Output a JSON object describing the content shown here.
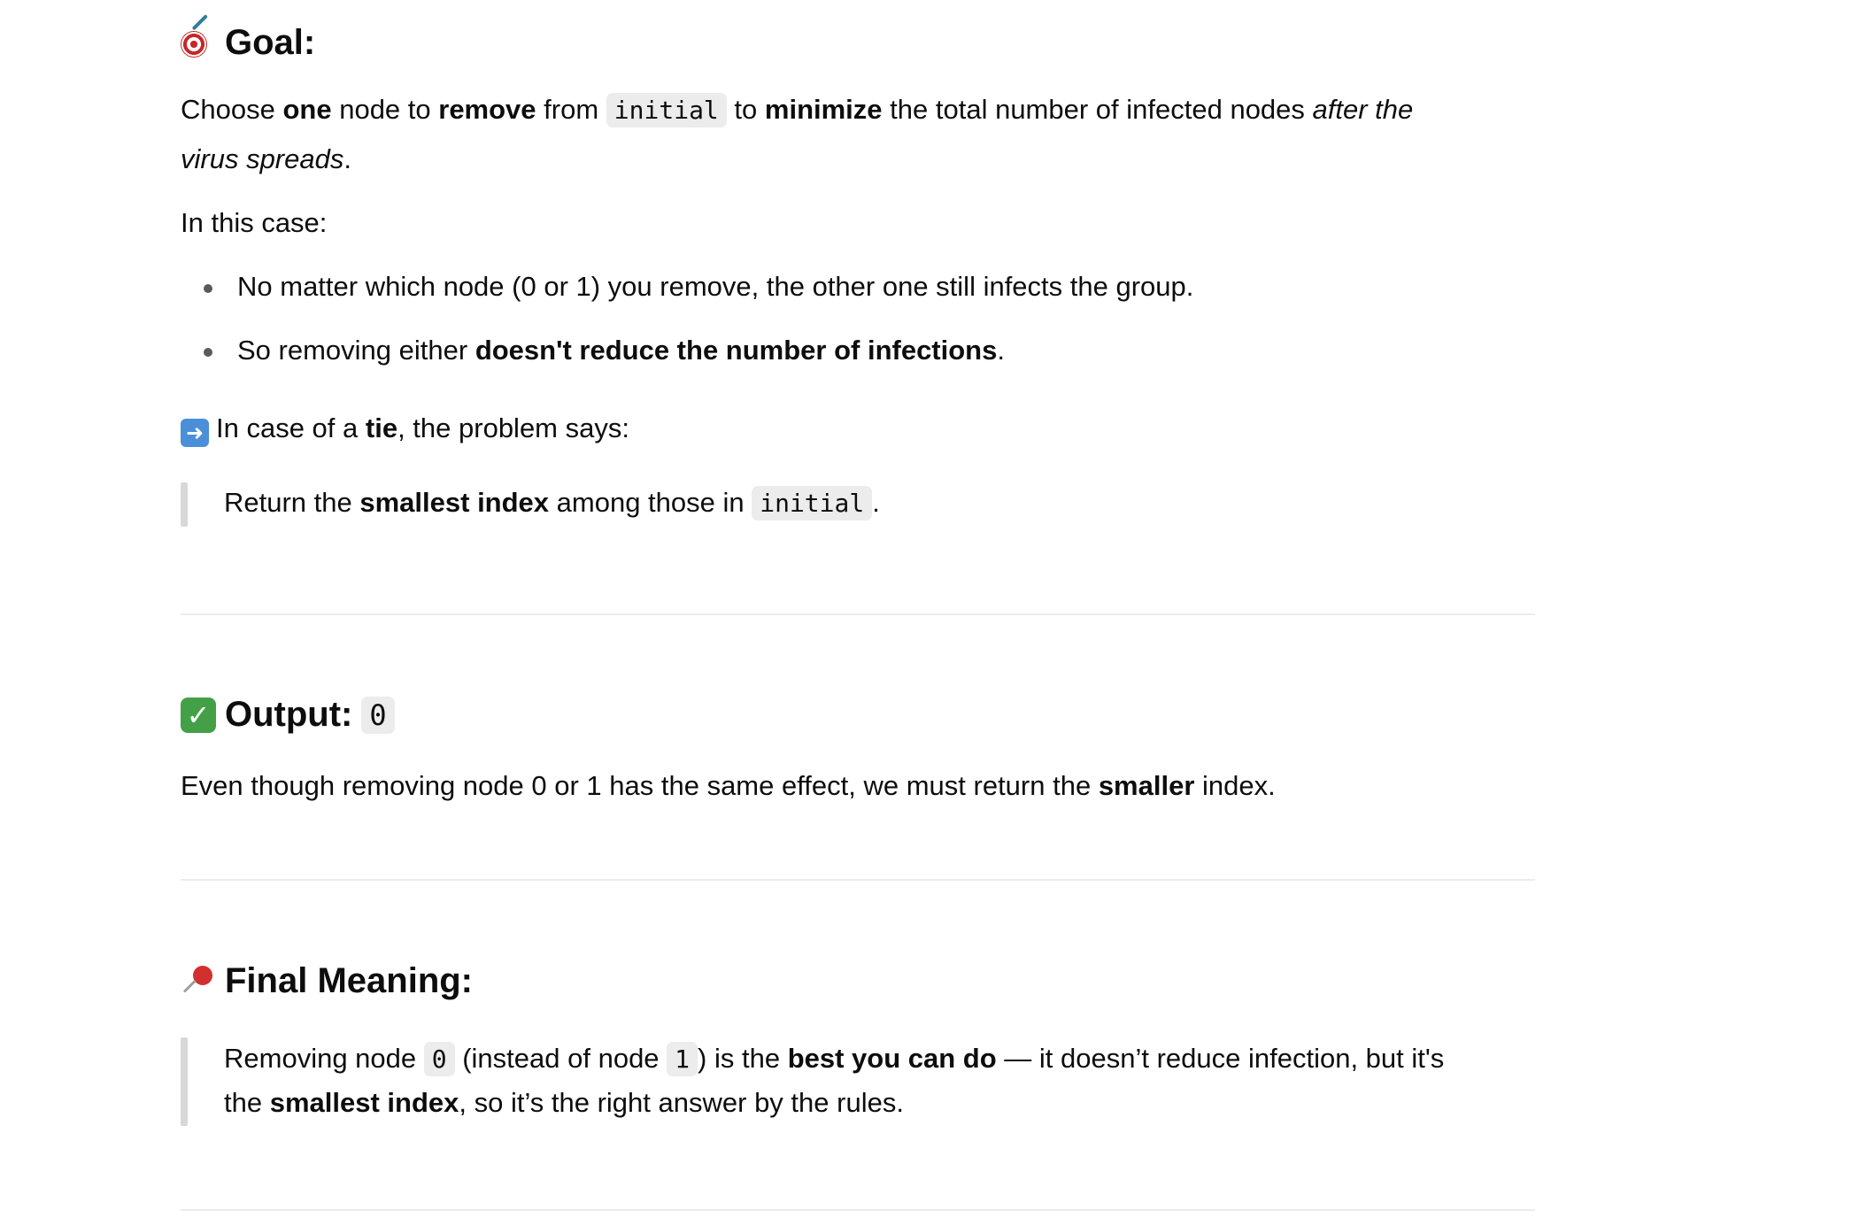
{
  "goal": {
    "title": "Goal:",
    "icon": "dart-target-icon",
    "line1": {
      "t1": "Choose ",
      "b1": "one",
      "t2": " node to ",
      "b2": "remove",
      "t3": " from ",
      "code": "initial",
      "t4": " to ",
      "b3": "minimize",
      "t5": " the total number of infected nodes ",
      "i1": "after the"
    },
    "line2": {
      "i2": "virus spreads",
      "t6": "."
    },
    "case_intro": "In this case:",
    "bullets": [
      {
        "text": "No matter which node (0 or 1) you remove, the other one still infects the group."
      },
      {
        "pre": "So removing either ",
        "bold": "doesn't reduce the number of infections",
        "post": "."
      }
    ],
    "tie": {
      "icon": "right-arrow-icon",
      "arrow_glyph": "➜",
      "t1": "In case of a ",
      "b1": "tie",
      "t2": ", the problem says:"
    },
    "quote": {
      "t1": "Return the ",
      "b1": "smallest index",
      "t2": " among those in ",
      "code": "initial",
      "t3": "."
    }
  },
  "output": {
    "title": "Output:",
    "icon": "check-mark-icon",
    "check_glyph": "✓",
    "value": "0",
    "desc": {
      "t1": "Even though removing node 0 or 1 has the same effect, we must return the ",
      "b1": "smaller",
      "t2": " index."
    }
  },
  "final": {
    "title": "Final Meaning:",
    "icon": "pushpin-icon",
    "quote": {
      "t1": "Removing node ",
      "c1": "0",
      "t2": " (instead of node ",
      "c2": "1",
      "t3": ") is the ",
      "b1": "best you can do",
      "t4": " — it doesn’t reduce infection, but it's",
      "t5": "the ",
      "b2": "smallest index",
      "t6": ", so it’s the right answer by the rules."
    }
  }
}
